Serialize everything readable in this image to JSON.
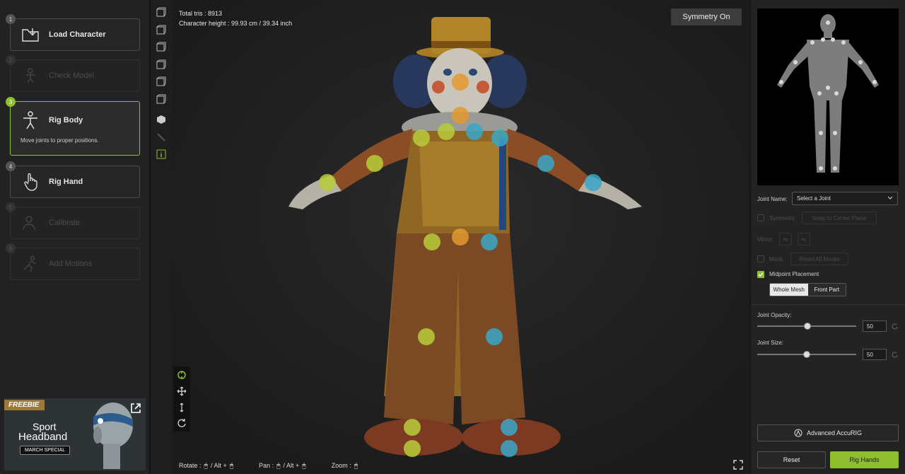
{
  "steps": [
    {
      "num": "1",
      "label": "Load Character",
      "state": "normal",
      "icon": "folder-download-icon"
    },
    {
      "num": "2",
      "label": "Check Model",
      "state": "disabled",
      "icon": "check-model-icon"
    },
    {
      "num": "3",
      "label": "Rig Body",
      "state": "active",
      "desc": "Move joints to proper positions.",
      "icon": "person-rig-icon"
    },
    {
      "num": "4",
      "label": "Rig Hand",
      "state": "normal",
      "icon": "hand-pointer-icon"
    },
    {
      "num": "5",
      "label": "Calibrate",
      "state": "disabled",
      "icon": "calibrate-icon"
    },
    {
      "num": "6",
      "label": "Add Motions",
      "state": "disabled",
      "icon": "motion-icon"
    }
  ],
  "ad": {
    "badge": "FREEBIE",
    "line1": "Sport",
    "line2": "Headband",
    "tag": "MARCH SPECIAL"
  },
  "viewport": {
    "total_tris": "Total tris : 8913",
    "char_height": "Character height : 99.93 cm / 39.34 inch",
    "symmetry_button": "Symmetry On",
    "hint_rotate": "Rotate  :",
    "hint_pan": "Pan  :",
    "hint_zoom": "Zoom  :",
    "hint_alt": "/ Alt +",
    "hint_alt2": "/ Alt +"
  },
  "right": {
    "joint_name_label": "Joint Name:",
    "joint_select": "Select a Joint",
    "symmetry_label": "Symmetry",
    "snap_button": "Snap to Center Plane",
    "mirror_label": "Mirror:",
    "mask_label": "Mask",
    "reset_masks_button": "Reset All Masks",
    "midpoint_label": "Midpoint Placement",
    "seg_whole": "Whole Mesh",
    "seg_front": "Front Part",
    "opacity_label": "Joint Opacity:",
    "opacity_value": "50",
    "size_label": "Joint Size:",
    "size_value": "50",
    "advanced_button": "Advanced AccuRIG",
    "reset_button": "Reset",
    "rig_hands_button": "Rig Hands"
  },
  "colors": {
    "accent": "#8fbf2e",
    "joint_left": "#b9cc3a",
    "joint_right": "#3aa7c7",
    "joint_center": "#e39a2e"
  }
}
